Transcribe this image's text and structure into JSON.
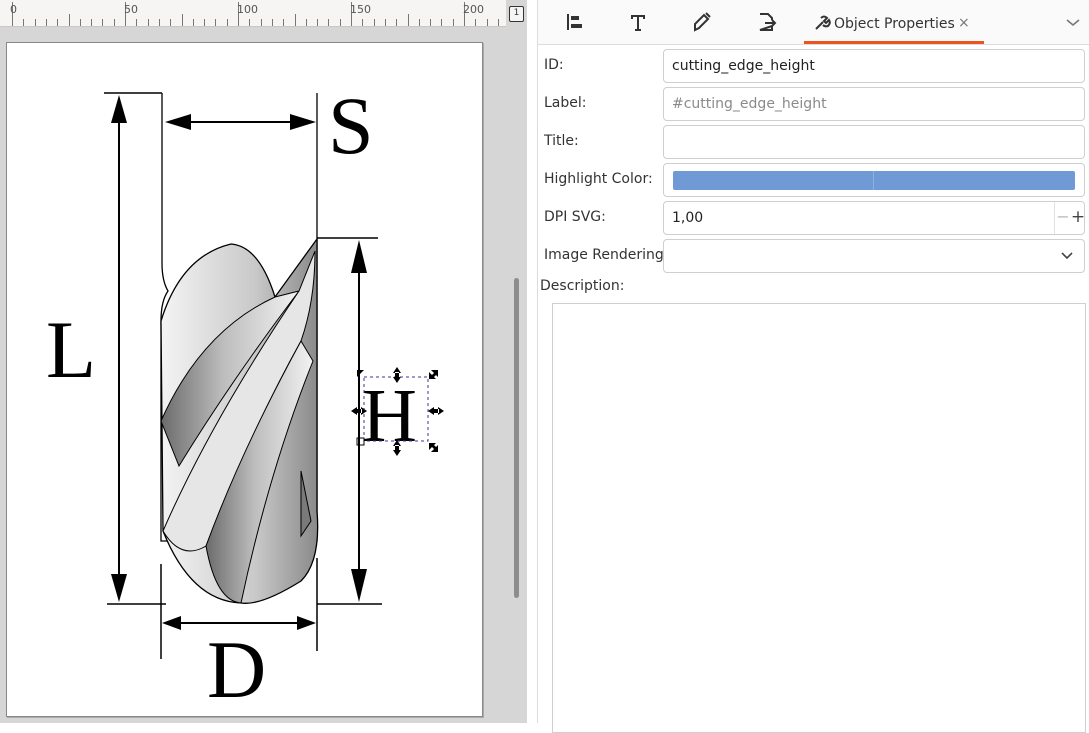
{
  "ruler": {
    "labels": [
      "0",
      "50",
      "100",
      "150",
      "200"
    ],
    "corner": "1"
  },
  "drawing": {
    "labels": {
      "s": "S",
      "l": "L",
      "h": "H",
      "d": "D"
    }
  },
  "panel": {
    "tabs": [
      {
        "icon": "align-distribute-icon"
      },
      {
        "icon": "text-font-icon"
      },
      {
        "icon": "fill-stroke-icon"
      },
      {
        "icon": "export-icon"
      }
    ],
    "active_tab": {
      "icon": "object-properties-icon",
      "title": "Object Properties",
      "close": "×"
    },
    "fields": {
      "id_label": "ID:",
      "id_value": "cutting_edge_height",
      "label_label": "Label:",
      "label_placeholder": "#cutting_edge_height",
      "title_label": "Title:",
      "title_value": "",
      "highlight_label": "Highlight Color:",
      "highlight_color": "#6f9ad6",
      "dpi_label": "DPI SVG:",
      "dpi_value": "1,00",
      "dpi_minus": "−",
      "dpi_plus": "+",
      "rendering_label": "Image Rendering:",
      "rendering_value": "",
      "description_label": "Description:",
      "description_value": ""
    }
  }
}
